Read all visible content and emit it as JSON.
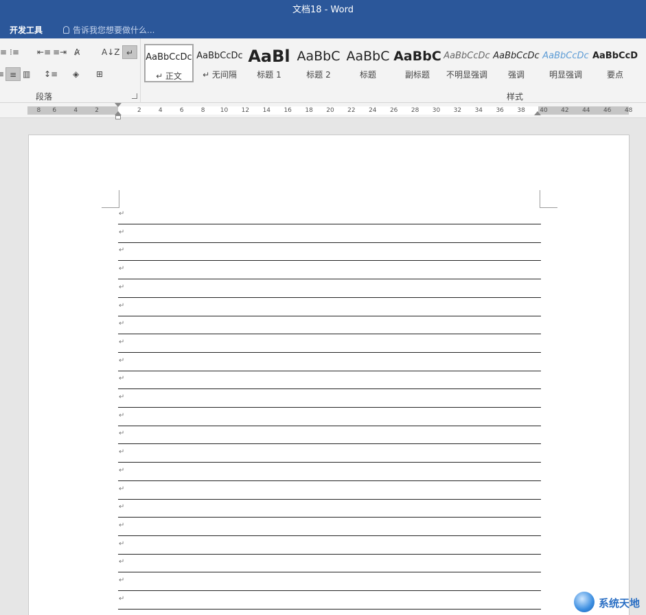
{
  "window": {
    "title": "文档18 - Word"
  },
  "menubar": {
    "tab": "开发工具",
    "tell_me": "告诉我您想要做什么..."
  },
  "ribbon": {
    "paragraph_group_label": "段落",
    "styles_group_label": "样式",
    "styles": [
      {
        "preview": "AaBbCcDc",
        "name": "↵ 正文"
      },
      {
        "preview": "AaBbCcDc",
        "name": "↵ 无间隔"
      },
      {
        "preview": "AaBl",
        "name": "标题 1"
      },
      {
        "preview": "AaBbC",
        "name": "标题 2"
      },
      {
        "preview": "AaBbC",
        "name": "标题"
      },
      {
        "preview": "AaBbC",
        "name": "副标题"
      },
      {
        "preview": "AaBbCcDc",
        "name": "不明显强调"
      },
      {
        "preview": "AaBbCcDc",
        "name": "强调"
      },
      {
        "preview": "AaBbCcDc",
        "name": "明显强调"
      },
      {
        "preview": "AaBbCcD",
        "name": "要点"
      }
    ],
    "toolbar_glyphs": {
      "bullets": "⁝≡",
      "multilevel": "⁝≡",
      "decrease_indent": "⇤≡",
      "increase_indent": "≡⇥",
      "chinese_layout": "A̷",
      "sort": "A↓Z",
      "show_marks": "↵",
      "align_left": "≡",
      "align_center": "≡",
      "justify": "▥",
      "line_spacing": "↕≡",
      "shading": "◈",
      "borders": "⊞"
    }
  },
  "ruler": {
    "labels": [
      "8",
      "6",
      "4",
      "2",
      "2",
      "4",
      "6",
      "8",
      "10",
      "12",
      "14",
      "16",
      "18",
      "20",
      "22",
      "24",
      "26",
      "28",
      "30",
      "32",
      "34",
      "36",
      "38",
      "40",
      "42",
      "44",
      "46",
      "48"
    ]
  },
  "document": {
    "paragraph_mark": "↵",
    "line_count": 22
  },
  "watermark": {
    "text": "系统天地"
  },
  "colors": {
    "accent": "#2b579a",
    "watermark": "#2b6fc4"
  }
}
